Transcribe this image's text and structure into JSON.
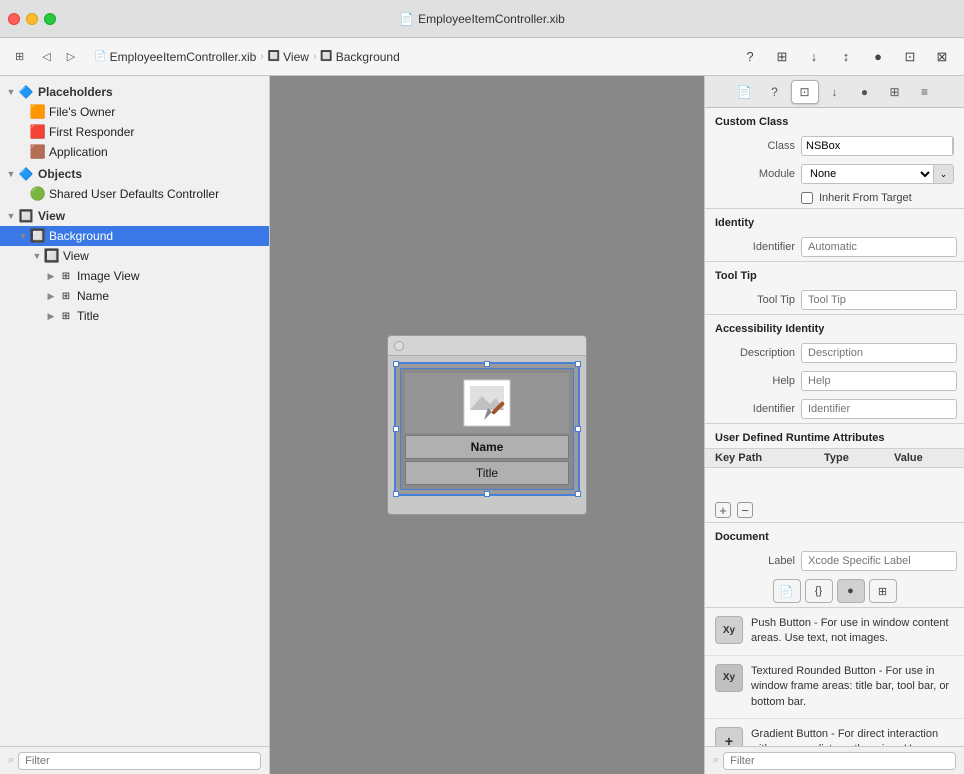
{
  "titlebar": {
    "title": "EmployeeItemController.xib"
  },
  "toolbar": {
    "breadcrumb": [
      {
        "label": "EmployeeItemController.xib",
        "icon": "📄"
      },
      {
        "label": "View",
        "icon": "🔲"
      },
      {
        "label": "Background",
        "icon": "🔲"
      }
    ],
    "tabs": [
      {
        "icon": "⊞",
        "label": "grid-tab"
      },
      {
        "icon": "◁",
        "label": "back-button"
      },
      {
        "icon": "▷",
        "label": "forward-button"
      }
    ],
    "right_icons": [
      "?",
      "⊞",
      "↓⊞",
      "↕",
      "●",
      "⊡",
      "⊠"
    ]
  },
  "left_panel": {
    "filter_placeholder": "Filter",
    "tree": {
      "sections": [
        {
          "name": "Placeholders",
          "icon": "🔷",
          "items": [
            {
              "label": "File's Owner",
              "icon": "🟧",
              "indent": 1
            },
            {
              "label": "First Responder",
              "icon": "🟥",
              "indent": 1
            },
            {
              "label": "Application",
              "icon": "🟫",
              "indent": 1
            }
          ]
        },
        {
          "name": "Objects",
          "icon": "🔷",
          "items": [
            {
              "label": "Shared User Defaults Controller",
              "icon": "🟢",
              "indent": 1
            }
          ]
        },
        {
          "name": "View",
          "icon": "🔲",
          "items": [
            {
              "label": "Background",
              "icon": "🔲",
              "indent": 1,
              "selected": true
            },
            {
              "label": "View",
              "icon": "🔲",
              "indent": 2
            },
            {
              "label": "Image View",
              "icon": "⊞",
              "indent": 3
            },
            {
              "label": "Name",
              "icon": "⊞",
              "indent": 3
            },
            {
              "label": "Title",
              "icon": "⊞",
              "indent": 3
            }
          ]
        }
      ]
    }
  },
  "canvas": {
    "name_label": "Name",
    "title_label": "Title"
  },
  "right_panel": {
    "tabs": [
      {
        "icon": "⊞",
        "id": "grid"
      },
      {
        "icon": "?",
        "id": "help"
      },
      {
        "icon": "⊡",
        "id": "identity"
      },
      {
        "icon": "↓",
        "id": "attributes"
      },
      {
        "icon": "●",
        "id": "connections"
      },
      {
        "icon": "⊠",
        "id": "size"
      },
      {
        "icon": "≡",
        "id": "effects"
      }
    ],
    "custom_class": {
      "title": "Custom Class",
      "class_label": "Class",
      "class_value": "NSBox",
      "module_label": "Module",
      "module_value": "None",
      "inherit_label": "Inherit From Target"
    },
    "identity": {
      "title": "Identity",
      "identifier_label": "Identifier",
      "identifier_placeholder": "Automatic"
    },
    "tool_tip": {
      "title": "Tool Tip",
      "label": "Tool Tip",
      "placeholder": "Tool Tip"
    },
    "accessibility": {
      "title": "Accessibility Identity",
      "description_label": "Description",
      "description_placeholder": "Description",
      "help_label": "Help",
      "help_placeholder": "Help",
      "identifier_label": "Identifier",
      "identifier_placeholder": "Identifier"
    },
    "runtime": {
      "title": "User Defined Runtime Attributes",
      "col_key": "Key Path",
      "col_type": "Type",
      "col_value": "Value"
    },
    "document": {
      "title": "Document",
      "label_label": "Label",
      "label_placeholder": "Xcode Specific Label",
      "doc_tabs": [
        "📄",
        "{}",
        "●",
        "⊞"
      ]
    },
    "objects": [
      {
        "icon": "Xy",
        "title": "Push Button",
        "desc": "Push Button - For use in window content areas. Use text, not images."
      },
      {
        "icon": "Xy",
        "title": "Textured Rounded Button",
        "desc": "Textured Rounded Button - For use in window frame areas: title bar, tool bar, or bottom bar."
      },
      {
        "icon": "+",
        "title": "Gradient Button",
        "desc": "Gradient Button - For direct interaction with a source list or other view. Use images, not text."
      }
    ]
  },
  "right_filter": {
    "placeholder": "Filter"
  }
}
